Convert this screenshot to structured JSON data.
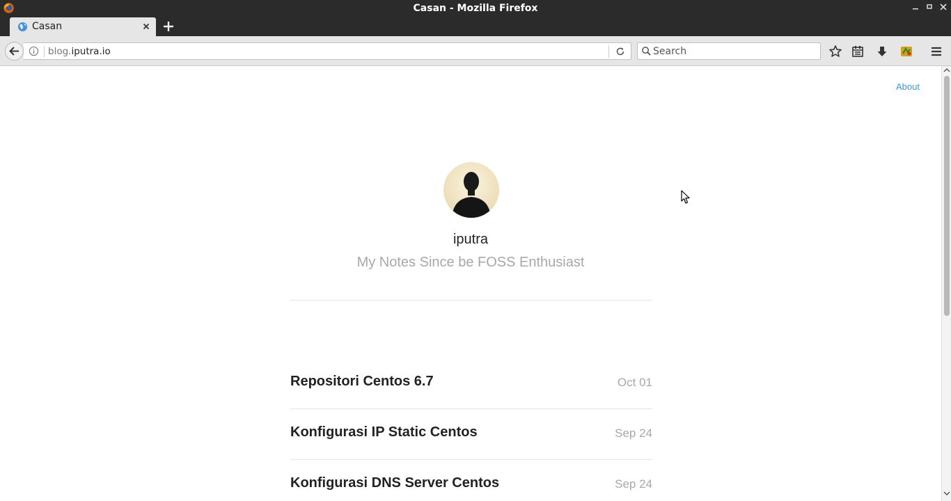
{
  "window": {
    "title": "Casan - Mozilla Firefox"
  },
  "tabs": [
    {
      "label": "Casan",
      "icon": "globe-icon"
    }
  ],
  "navbar": {
    "url_prefix": "blog.",
    "url_domain": "iputra.io",
    "search_placeholder": "Search"
  },
  "page": {
    "nav_about": "About",
    "author": "iputra",
    "tagline": "My Notes Since be FOSS Enthusiast",
    "posts": [
      {
        "title": "Repositori Centos 6.7",
        "date": "Oct 01"
      },
      {
        "title": "Konfigurasi IP Static Centos",
        "date": "Sep 24"
      },
      {
        "title": "Konfigurasi DNS Server Centos",
        "date": "Sep 24"
      }
    ]
  },
  "colors": {
    "link": "#3a99d8",
    "muted": "#a8a8a8",
    "chrome_dark": "#2b2b2b",
    "toolbar": "#e6e6e6"
  }
}
